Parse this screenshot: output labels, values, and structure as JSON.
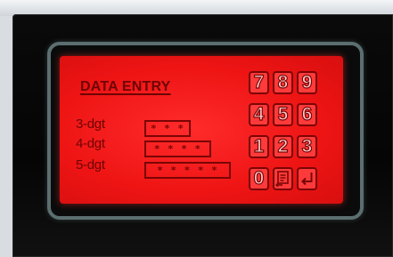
{
  "screen": {
    "title": "DATA ENTRY",
    "fields": [
      {
        "label": "3-dgt",
        "value": "* * *"
      },
      {
        "label": "4-dgt",
        "value": "* * * *"
      },
      {
        "label": "5-dgt",
        "value": "* * * * *"
      }
    ]
  },
  "keypad": {
    "keys": [
      "7",
      "8",
      "9",
      "4",
      "5",
      "6",
      "1",
      "2",
      "3",
      "0"
    ],
    "icons": [
      "backspace-icon",
      "enter-icon"
    ]
  },
  "colors": {
    "lcd_background": "#ee1414",
    "lcd_text": "#6e0404",
    "bezel": "#5b6e70",
    "device_frame": "#0a0a0a"
  }
}
